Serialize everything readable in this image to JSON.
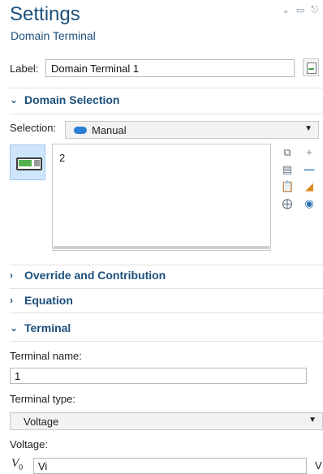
{
  "header": {
    "title": "Settings",
    "subtitle": "Domain Terminal"
  },
  "label": {
    "caption": "Label:",
    "value": "Domain Terminal 1"
  },
  "sections": {
    "domain_selection": "Domain Selection",
    "override": "Override and Contribution",
    "equation": "Equation",
    "terminal": "Terminal"
  },
  "selection": {
    "caption": "Selection:",
    "value": "Manual",
    "items": [
      "2"
    ]
  },
  "terminal": {
    "name_label": "Terminal name:",
    "name_value": "1",
    "type_label": "Terminal type:",
    "type_value": "Voltage",
    "voltage_label": "Voltage:",
    "voltage_symbol": "V",
    "voltage_subscript": "0",
    "voltage_value": "Vi",
    "voltage_unit": "V"
  },
  "icons": [
    "chevron-down-icon",
    "chevron-right-icon",
    "copy-icon",
    "paste-icon",
    "zoom-selection-icon",
    "add-icon",
    "remove-icon",
    "clear-icon",
    "show-icon",
    "dropdown-arrow-icon"
  ]
}
